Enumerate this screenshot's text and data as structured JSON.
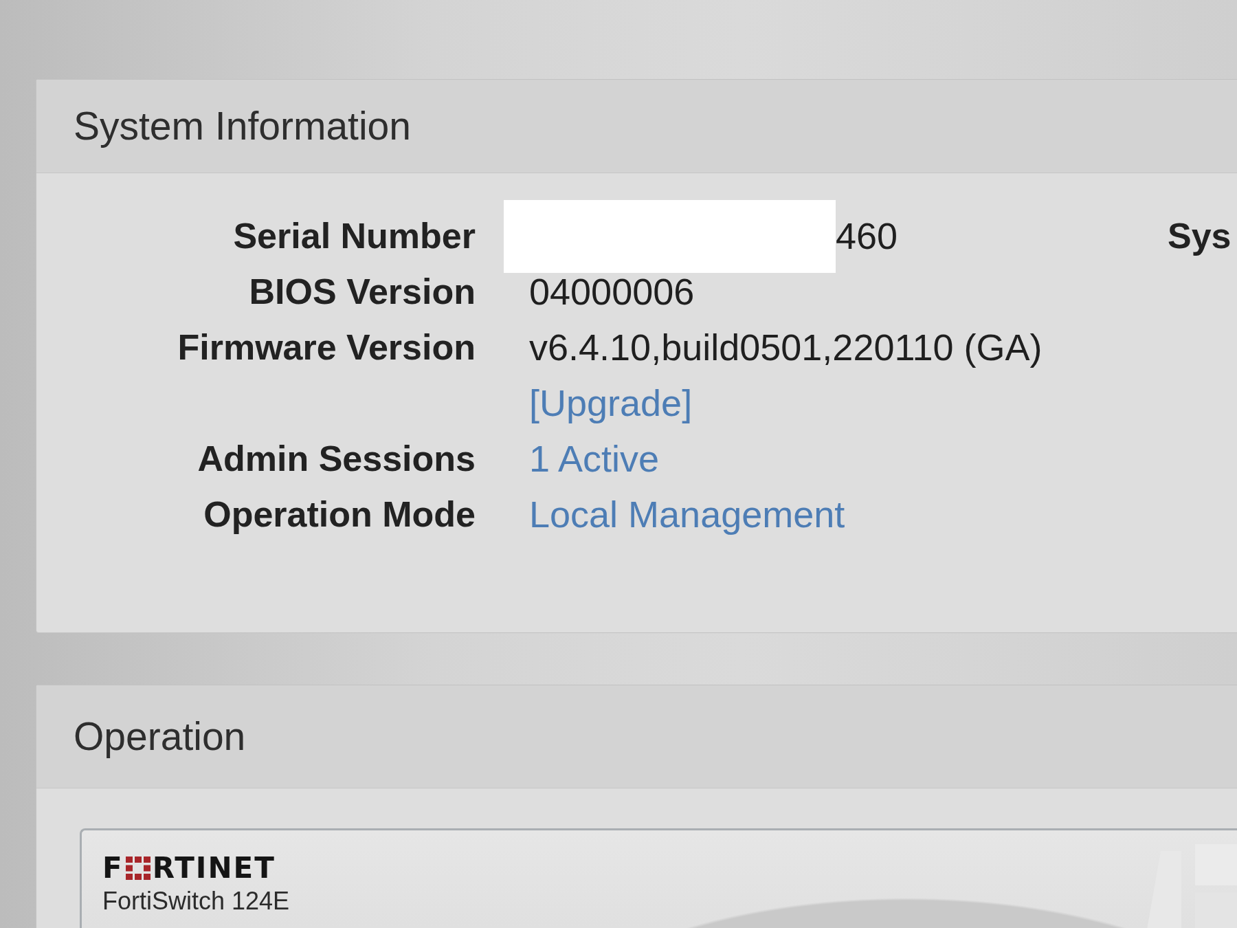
{
  "panels": [
    {
      "kind": "info",
      "title": "System Information",
      "rows": [
        {
          "label": "Serial Number",
          "values": [
            {
              "text": "460",
              "kind": "text",
              "redacted": true
            }
          ]
        },
        {
          "label": "BIOS Version",
          "values": [
            {
              "text": "04000006",
              "kind": "text",
              "redacted": false
            }
          ]
        },
        {
          "label": "Firmware Version",
          "values": [
            {
              "text": "v6.4.10,build0501,220110 (GA)",
              "kind": "text",
              "redacted": false
            },
            {
              "text": "[Upgrade]",
              "kind": "link",
              "redacted": false
            }
          ]
        },
        {
          "label": "Admin Sessions",
          "values": [
            {
              "text": "1 Active",
              "kind": "link",
              "redacted": false
            }
          ]
        },
        {
          "label": "Operation Mode",
          "values": [
            {
              "text": "Local Management",
              "kind": "link",
              "redacted": false
            }
          ]
        }
      ],
      "side_label": "Sys"
    },
    {
      "kind": "device",
      "title": "Operation",
      "device": {
        "logo": {
          "lead": "F",
          "tail": "RTINET"
        },
        "model": "FortiSwitch 124E"
      }
    }
  ]
}
